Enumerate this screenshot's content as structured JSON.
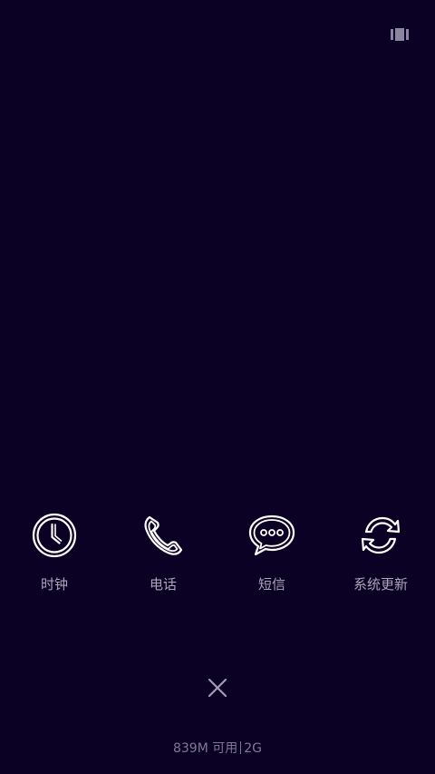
{
  "apps": [
    {
      "label": "时钟",
      "icon": "clock-icon"
    },
    {
      "label": "电话",
      "icon": "phone-icon"
    },
    {
      "label": "短信",
      "icon": "message-icon"
    },
    {
      "label": "系统更新",
      "icon": "refresh-icon"
    }
  ],
  "memory": {
    "available": "839M 可用",
    "total": "2G"
  },
  "colors": {
    "background": "#0a0124",
    "icon": "#ffffff",
    "label": "#a9a6b8",
    "muted": "#7f7a92"
  }
}
